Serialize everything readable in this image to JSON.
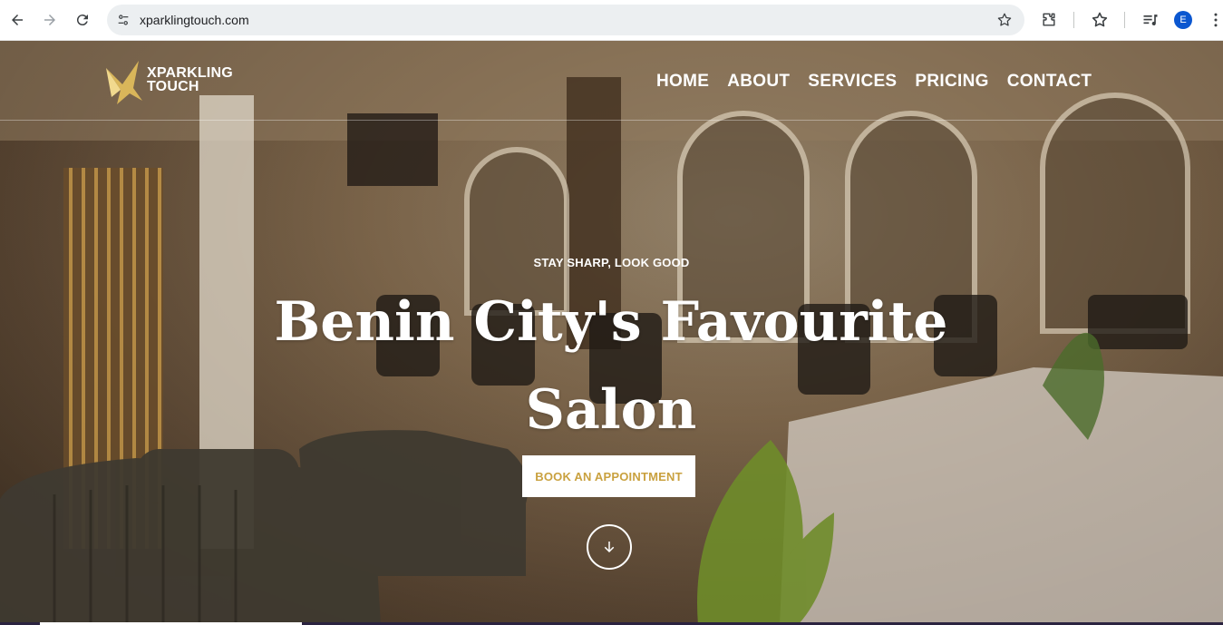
{
  "browser": {
    "url": "xparklingtouch.com",
    "profile_initial": "E",
    "icons": {
      "back": "arrow-left-icon",
      "forward": "arrow-right-icon",
      "reload": "reload-icon",
      "site_info": "tune-icon",
      "bookmark": "star-icon",
      "extensions": "puzzle-icon",
      "bookmarks_bar": "star-list-icon",
      "media": "media-queue-icon",
      "menu": "kebab-menu-icon"
    }
  },
  "site": {
    "logo": {
      "line1": "XPARKLING",
      "line2": "TOUCH"
    },
    "nav": [
      {
        "label": "HOME"
      },
      {
        "label": "ABOUT"
      },
      {
        "label": "SERVICES"
      },
      {
        "label": "PRICING"
      },
      {
        "label": "CONTACT"
      }
    ],
    "hero": {
      "tagline": "STAY SHARP, LOOK GOOD",
      "headline_line1": "Benin City's Favourite",
      "headline_line2": "Salon",
      "cta_label": "BOOK AN APPOINTMENT",
      "scroll_icon": "arrow-down-circle-icon"
    }
  },
  "colors": {
    "brand_gold": "#c9a13f",
    "avatar_blue": "#0b57d0",
    "omnibox_bg": "#eceff1"
  }
}
